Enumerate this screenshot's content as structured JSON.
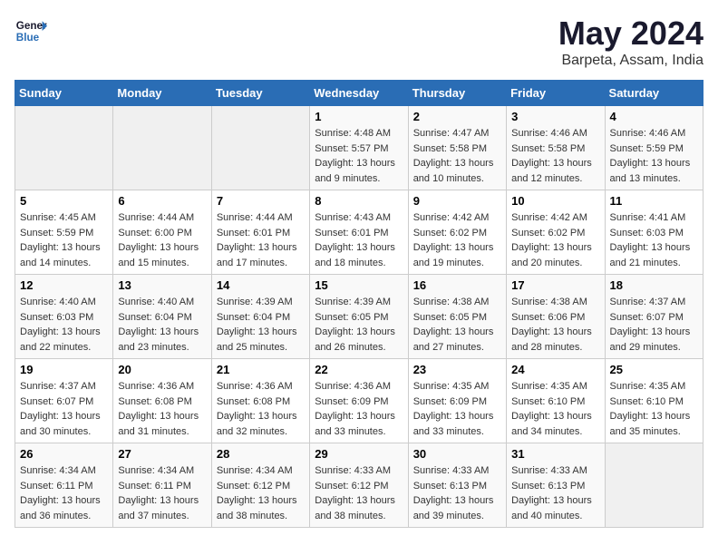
{
  "logo": {
    "line1": "General",
    "line2": "Blue"
  },
  "title": "May 2024",
  "location": "Barpeta, Assam, India",
  "weekdays": [
    "Sunday",
    "Monday",
    "Tuesday",
    "Wednesday",
    "Thursday",
    "Friday",
    "Saturday"
  ],
  "weeks": [
    [
      {
        "day": "",
        "sunrise": "",
        "sunset": "",
        "daylight": ""
      },
      {
        "day": "",
        "sunrise": "",
        "sunset": "",
        "daylight": ""
      },
      {
        "day": "",
        "sunrise": "",
        "sunset": "",
        "daylight": ""
      },
      {
        "day": "1",
        "sunrise": "4:48 AM",
        "sunset": "5:57 PM",
        "daylight": "13 hours and 9 minutes."
      },
      {
        "day": "2",
        "sunrise": "4:47 AM",
        "sunset": "5:58 PM",
        "daylight": "13 hours and 10 minutes."
      },
      {
        "day": "3",
        "sunrise": "4:46 AM",
        "sunset": "5:58 PM",
        "daylight": "13 hours and 12 minutes."
      },
      {
        "day": "4",
        "sunrise": "4:46 AM",
        "sunset": "5:59 PM",
        "daylight": "13 hours and 13 minutes."
      }
    ],
    [
      {
        "day": "5",
        "sunrise": "4:45 AM",
        "sunset": "5:59 PM",
        "daylight": "13 hours and 14 minutes."
      },
      {
        "day": "6",
        "sunrise": "4:44 AM",
        "sunset": "6:00 PM",
        "daylight": "13 hours and 15 minutes."
      },
      {
        "day": "7",
        "sunrise": "4:44 AM",
        "sunset": "6:01 PM",
        "daylight": "13 hours and 17 minutes."
      },
      {
        "day": "8",
        "sunrise": "4:43 AM",
        "sunset": "6:01 PM",
        "daylight": "13 hours and 18 minutes."
      },
      {
        "day": "9",
        "sunrise": "4:42 AM",
        "sunset": "6:02 PM",
        "daylight": "13 hours and 19 minutes."
      },
      {
        "day": "10",
        "sunrise": "4:42 AM",
        "sunset": "6:02 PM",
        "daylight": "13 hours and 20 minutes."
      },
      {
        "day": "11",
        "sunrise": "4:41 AM",
        "sunset": "6:03 PM",
        "daylight": "13 hours and 21 minutes."
      }
    ],
    [
      {
        "day": "12",
        "sunrise": "4:40 AM",
        "sunset": "6:03 PM",
        "daylight": "13 hours and 22 minutes."
      },
      {
        "day": "13",
        "sunrise": "4:40 AM",
        "sunset": "6:04 PM",
        "daylight": "13 hours and 23 minutes."
      },
      {
        "day": "14",
        "sunrise": "4:39 AM",
        "sunset": "6:04 PM",
        "daylight": "13 hours and 25 minutes."
      },
      {
        "day": "15",
        "sunrise": "4:39 AM",
        "sunset": "6:05 PM",
        "daylight": "13 hours and 26 minutes."
      },
      {
        "day": "16",
        "sunrise": "4:38 AM",
        "sunset": "6:05 PM",
        "daylight": "13 hours and 27 minutes."
      },
      {
        "day": "17",
        "sunrise": "4:38 AM",
        "sunset": "6:06 PM",
        "daylight": "13 hours and 28 minutes."
      },
      {
        "day": "18",
        "sunrise": "4:37 AM",
        "sunset": "6:07 PM",
        "daylight": "13 hours and 29 minutes."
      }
    ],
    [
      {
        "day": "19",
        "sunrise": "4:37 AM",
        "sunset": "6:07 PM",
        "daylight": "13 hours and 30 minutes."
      },
      {
        "day": "20",
        "sunrise": "4:36 AM",
        "sunset": "6:08 PM",
        "daylight": "13 hours and 31 minutes."
      },
      {
        "day": "21",
        "sunrise": "4:36 AM",
        "sunset": "6:08 PM",
        "daylight": "13 hours and 32 minutes."
      },
      {
        "day": "22",
        "sunrise": "4:36 AM",
        "sunset": "6:09 PM",
        "daylight": "13 hours and 33 minutes."
      },
      {
        "day": "23",
        "sunrise": "4:35 AM",
        "sunset": "6:09 PM",
        "daylight": "13 hours and 33 minutes."
      },
      {
        "day": "24",
        "sunrise": "4:35 AM",
        "sunset": "6:10 PM",
        "daylight": "13 hours and 34 minutes."
      },
      {
        "day": "25",
        "sunrise": "4:35 AM",
        "sunset": "6:10 PM",
        "daylight": "13 hours and 35 minutes."
      }
    ],
    [
      {
        "day": "26",
        "sunrise": "4:34 AM",
        "sunset": "6:11 PM",
        "daylight": "13 hours and 36 minutes."
      },
      {
        "day": "27",
        "sunrise": "4:34 AM",
        "sunset": "6:11 PM",
        "daylight": "13 hours and 37 minutes."
      },
      {
        "day": "28",
        "sunrise": "4:34 AM",
        "sunset": "6:12 PM",
        "daylight": "13 hours and 38 minutes."
      },
      {
        "day": "29",
        "sunrise": "4:33 AM",
        "sunset": "6:12 PM",
        "daylight": "13 hours and 38 minutes."
      },
      {
        "day": "30",
        "sunrise": "4:33 AM",
        "sunset": "6:13 PM",
        "daylight": "13 hours and 39 minutes."
      },
      {
        "day": "31",
        "sunrise": "4:33 AM",
        "sunset": "6:13 PM",
        "daylight": "13 hours and 40 minutes."
      },
      {
        "day": "",
        "sunrise": "",
        "sunset": "",
        "daylight": ""
      }
    ]
  ]
}
